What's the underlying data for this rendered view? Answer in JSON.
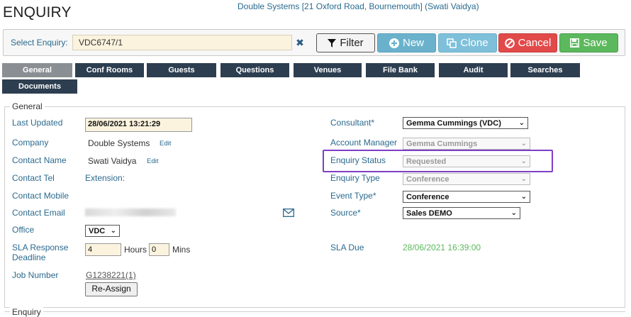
{
  "header": {
    "title": "ENQUIRY",
    "client_info": "Double Systems [21 Oxford Road, Bournemouth] (Swati Vaidya)"
  },
  "toolbar": {
    "select_label": "Select Enquiry:",
    "select_value": "VDC6747/1",
    "clear_glyph": "✖",
    "filter_label": "Filter",
    "new_label": "New",
    "clone_label": "Clone",
    "cancel_label": "Cancel",
    "save_label": "Save"
  },
  "tabs": [
    "General",
    "Conf Rooms",
    "Guests",
    "Questions",
    "Venues",
    "File Bank",
    "Audit",
    "Searches",
    "Documents"
  ],
  "active_tab": "General",
  "general": {
    "legend": "General",
    "last_updated_label": "Last Updated",
    "last_updated_value": "28/06/2021 13:21:29",
    "company_label": "Company",
    "company_value": "Double Systems",
    "edit_label": "Edit",
    "contact_name_label": "Contact Name",
    "contact_name_value": "Swati Vaidya",
    "contact_tel_label": "Contact Tel",
    "extension_label": "Extension:",
    "contact_mobile_label": "Contact Mobile",
    "contact_email_label": "Contact Email",
    "office_label": "Office",
    "office_value": "VDC",
    "sla_label_line1": "SLA Response",
    "sla_label_line2": "Deadline",
    "sla_hours_value": "4",
    "hours_label": "Hours",
    "sla_mins_value": "0",
    "mins_label": "Mins",
    "job_number_label": "Job Number",
    "job_number_value": "G1238221(1)",
    "reassign_label": "Re-Assign",
    "consultant_label": "Consultant*",
    "consultant_value": "Gemma Cummings (VDC)",
    "account_manager_label": "Account Manager",
    "account_manager_value": "Gemma Cummings",
    "enquiry_status_label": "Enquiry Status",
    "enquiry_status_value": "Requested",
    "enquiry_type_label": "Enquiry Type",
    "enquiry_type_value": "Conference",
    "event_type_label": "Event Type*",
    "event_type_value": "Conference",
    "source_label": "Source*",
    "source_value": "Sales DEMO",
    "sla_due_label": "SLA Due",
    "sla_due_value": "28/06/2021 16:39:00"
  },
  "enquiry_section": {
    "legend": "Enquiry"
  },
  "colors": {
    "tab_bg": "#2d3e50",
    "tab_active": "#8a8f94",
    "label_blue": "#2a6a8e",
    "sla_due_green": "#5cb85c",
    "highlight": "#7e3fc5"
  }
}
